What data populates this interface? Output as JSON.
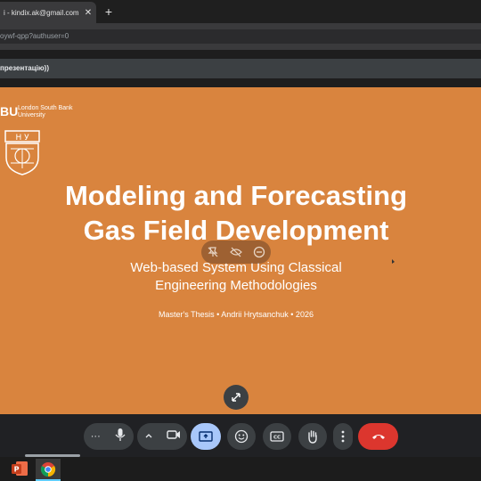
{
  "browser": {
    "tab_title": "i - kindix.ak@gmail.com",
    "tab_close": "✕",
    "new_tab": "+",
    "url": "oywf-qpp?authuser=0"
  },
  "presentation_bar": {
    "title": "презентацію))"
  },
  "slide": {
    "logo_mark": "BU",
    "university": "London South Bank University",
    "title_line1": "Modeling and Forecasting",
    "title_line2": "Gas Field Development",
    "subtitle_line1": "Web-based System Using Classical",
    "subtitle_line2": "Engineering Methodologies",
    "meta": "Master's Thesis • Andrii Hrytsanchuk • 2026",
    "background_color": "#d9843e"
  },
  "overlay_controls": [
    "pin-off-icon",
    "visibility-off-icon",
    "remove-icon"
  ],
  "toolbar": {
    "more_label": "···",
    "buttons": [
      "more-options",
      "microphone",
      "chevron-up",
      "camera",
      "present-screen",
      "emoji",
      "captions",
      "raise-hand",
      "more-vert",
      "end-call"
    ],
    "accent_active": "#a8c7fa",
    "end_call_color": "#dc362e"
  },
  "taskbar": {
    "apps": [
      "powerpoint-icon",
      "chrome-icon"
    ]
  }
}
